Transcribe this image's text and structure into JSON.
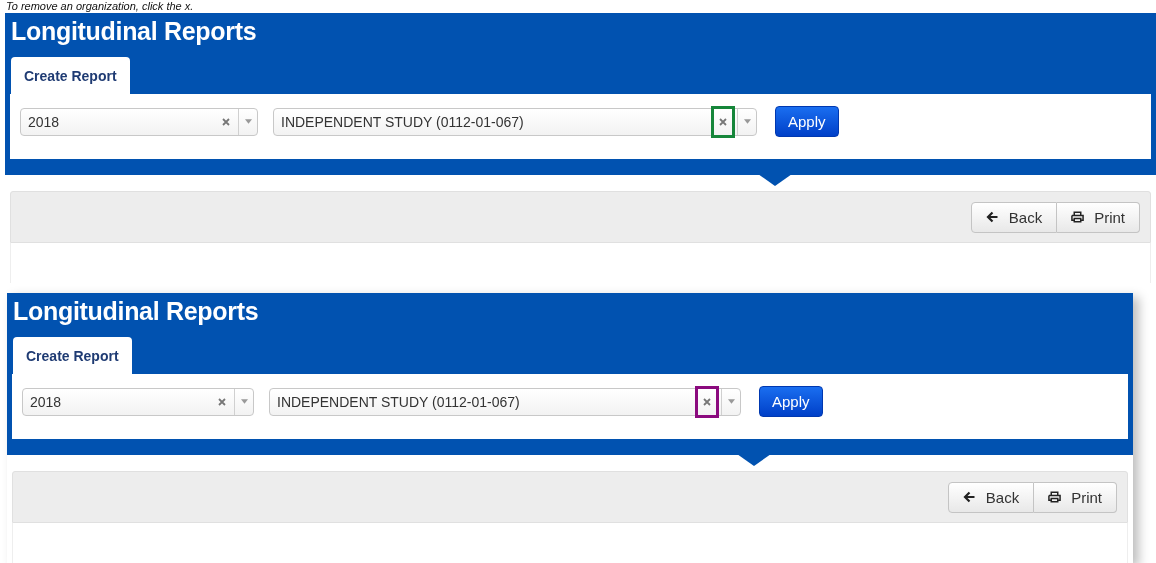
{
  "caption": "To remove an organization, click the x.",
  "screens": [
    {
      "title": "Longitudinal Reports",
      "tabs": [
        {
          "label": "Create Report",
          "selected": true
        }
      ],
      "year_select": {
        "value": "2018"
      },
      "org_select": {
        "value": "INDEPENDENT STUDY (0112-01-067)"
      },
      "highlight": {
        "color": "#16863a"
      },
      "apply": "Apply",
      "back": "Back",
      "print": "Print"
    },
    {
      "title": "Longitudinal Reports",
      "tabs": [
        {
          "label": "Create Report",
          "selected": true
        }
      ],
      "year_select": {
        "value": "2018"
      },
      "org_select": {
        "value": "INDEPENDENT STUDY (0112-01-067)"
      },
      "highlight": {
        "color": "#8b0a7e"
      },
      "apply": "Apply",
      "back": "Back",
      "print": "Print"
    }
  ]
}
